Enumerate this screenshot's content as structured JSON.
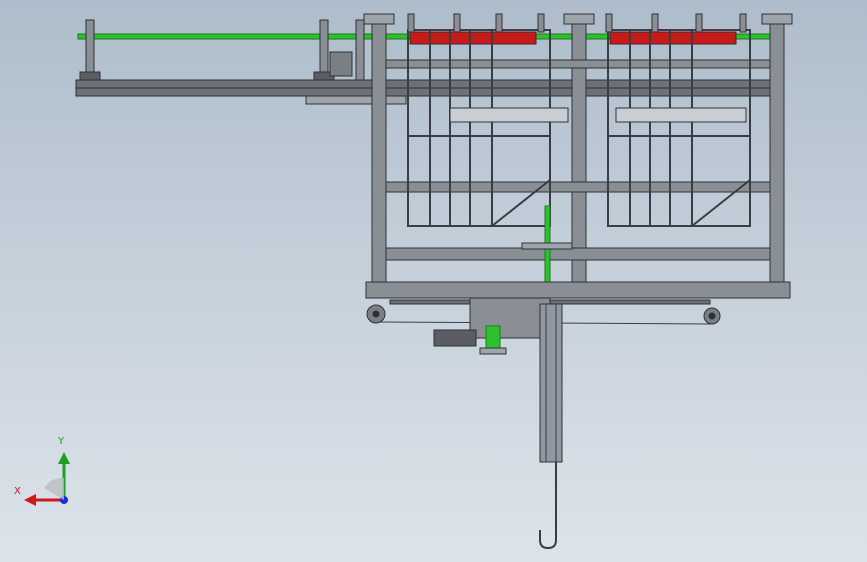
{
  "window": {
    "title": ""
  },
  "viewport": {
    "background_top": "#aebccb",
    "background_bottom": "#dde3ea"
  },
  "triad": {
    "y_label": "Y",
    "x_label": "X",
    "y_color": "#1ea11e",
    "x_color": "#d01818",
    "z_color": "#1a2fd8"
  },
  "model": {
    "steel_color": "#8a8f96",
    "steel_dark": "#3a3d42",
    "pipe_color": "#2ec02e",
    "accent_red": "#c81818"
  }
}
